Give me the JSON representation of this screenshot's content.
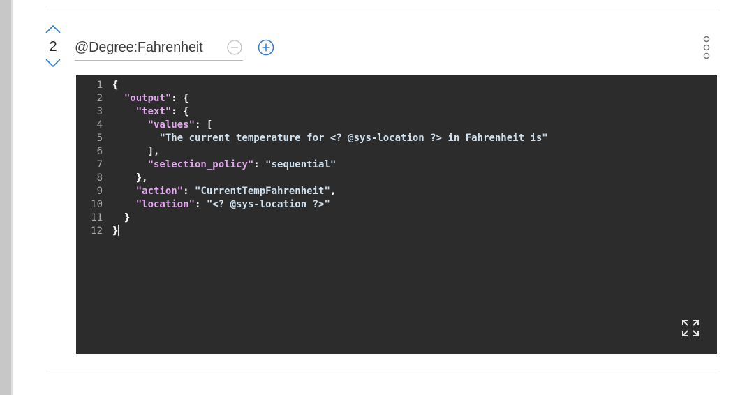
{
  "response": {
    "step_number": "2",
    "condition": "@Degree:Fahrenheit",
    "icons": {
      "move_up": "chevron-up-icon",
      "move_down": "chevron-down-icon",
      "remove_condition": "minus-circle-icon",
      "add_condition": "plus-circle-icon",
      "overflow_menu": "vertical-dots-icon",
      "expand_editor": "expand-icon"
    },
    "colors": {
      "accent": "#2d7bd6",
      "editor_bg": "#2c2c2c",
      "key_color": "#e3a8ee",
      "string_color": "#cfe0ee"
    }
  },
  "editor": {
    "line_numbers": [
      "1",
      "2",
      "3",
      "4",
      "5",
      "6",
      "7",
      "8",
      "9",
      "10",
      "11",
      "12"
    ],
    "lines": [
      [
        {
          "t": "p",
          "v": "{"
        }
      ],
      [
        {
          "t": "p",
          "v": "  "
        },
        {
          "t": "k",
          "v": "\"output\""
        },
        {
          "t": "p",
          "v": ": {"
        }
      ],
      [
        {
          "t": "p",
          "v": "    "
        },
        {
          "t": "k",
          "v": "\"text\""
        },
        {
          "t": "p",
          "v": ": {"
        }
      ],
      [
        {
          "t": "p",
          "v": "      "
        },
        {
          "t": "k",
          "v": "\"values\""
        },
        {
          "t": "p",
          "v": ": ["
        }
      ],
      [
        {
          "t": "p",
          "v": "        "
        },
        {
          "t": "s",
          "v": "\"The current temperature for <? @sys-location ?> in Fahrenheit is\""
        }
      ],
      [
        {
          "t": "p",
          "v": "      ],"
        }
      ],
      [
        {
          "t": "p",
          "v": "      "
        },
        {
          "t": "k",
          "v": "\"selection_policy\""
        },
        {
          "t": "p",
          "v": ": "
        },
        {
          "t": "s",
          "v": "\"sequential\""
        }
      ],
      [
        {
          "t": "p",
          "v": "    },"
        }
      ],
      [
        {
          "t": "p",
          "v": "    "
        },
        {
          "t": "k",
          "v": "\"action\""
        },
        {
          "t": "p",
          "v": ": "
        },
        {
          "t": "s",
          "v": "\"CurrentTempFahrenheit\""
        },
        {
          "t": "p",
          "v": ","
        }
      ],
      [
        {
          "t": "p",
          "v": "    "
        },
        {
          "t": "k",
          "v": "\"location\""
        },
        {
          "t": "p",
          "v": ": "
        },
        {
          "t": "s",
          "v": "\"<? @sys-location ?>\""
        }
      ],
      [
        {
          "t": "p",
          "v": "  }"
        }
      ],
      [
        {
          "t": "p",
          "v": "}"
        }
      ]
    ]
  }
}
